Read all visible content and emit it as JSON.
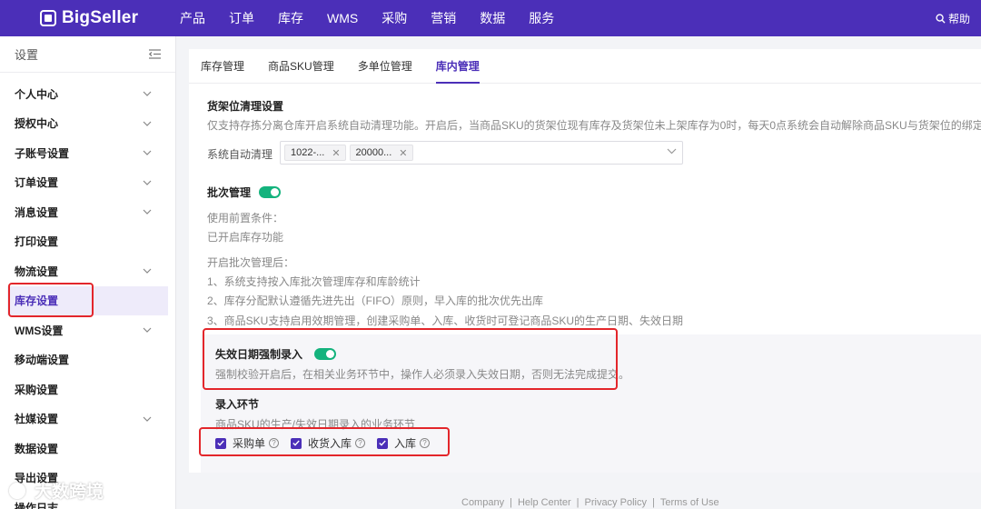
{
  "topbar": {
    "logo_text": "BigSeller",
    "nav": [
      "产品",
      "订单",
      "库存",
      "WMS",
      "采购",
      "营销",
      "数据",
      "服务"
    ],
    "help_label": "帮助",
    "color": "#4b2fb8"
  },
  "sidebar": {
    "title": "设置",
    "items": [
      {
        "label": "个人中心",
        "chevron": true
      },
      {
        "label": "授权中心",
        "chevron": true
      },
      {
        "label": "子账号设置",
        "chevron": true
      },
      {
        "label": "订单设置",
        "chevron": true
      },
      {
        "label": "消息设置",
        "chevron": true
      },
      {
        "label": "打印设置",
        "chevron": false
      },
      {
        "label": "物流设置",
        "chevron": true
      },
      {
        "label": "库存设置",
        "chevron": false,
        "active": true
      },
      {
        "label": "WMS设置",
        "chevron": true
      },
      {
        "label": "移动端设置",
        "chevron": false
      },
      {
        "label": "采购设置",
        "chevron": false
      },
      {
        "label": "社媒设置",
        "chevron": true
      },
      {
        "label": "数据设置",
        "chevron": false
      },
      {
        "label": "导出设置",
        "chevron": false
      },
      {
        "label": "操作日志",
        "chevron": false
      }
    ]
  },
  "tabs": [
    "库存管理",
    "商品SKU管理",
    "多单位管理",
    "库内管理"
  ],
  "active_tab": "库内管理",
  "shelf": {
    "title": "货架位清理设置",
    "desc": "仅支持存拣分离仓库开启系统自动清理功能。开启后，当商品SKU的货架位现有库存及货架位未上架库存为0时，每天0点系统会自动解除商品SKU与货架位的绑定关系",
    "field_label": "系统自动清理",
    "tags": [
      "1022-...",
      "20000..."
    ]
  },
  "batch": {
    "title": "批次管理",
    "toggle_on": true,
    "pre_label": "使用前置条件：",
    "pre_value": "已开启库存功能",
    "after_label": "开启批次管理后：",
    "points": [
      "1、系统支持按入库批次管理库存和库龄统计",
      "2、库存分配默认遵循先进先出（FIFO）原则，早入库的批次优先出库",
      "3、商品SKU支持启用效期管理，创建采购单、入库、收货时可登记商品SKU的生产日期、失效日期"
    ]
  },
  "expiry": {
    "title": "失效日期强制录入",
    "toggle_on": true,
    "desc": "强制校验开启后，在相关业务环节中，操作人必须录入失效日期，否则无法完成提交。"
  },
  "entry": {
    "title": "录入环节",
    "desc": "商品SKU的生产/失效日期录入的业务环节",
    "options": [
      {
        "label": "采购单",
        "checked": true
      },
      {
        "label": "收货入库",
        "checked": true
      },
      {
        "label": "入库",
        "checked": true
      }
    ]
  },
  "footer": [
    "Company",
    "Help Center",
    "Privacy Policy",
    "Terms of Use"
  ],
  "watermark_text": "大数跨境"
}
